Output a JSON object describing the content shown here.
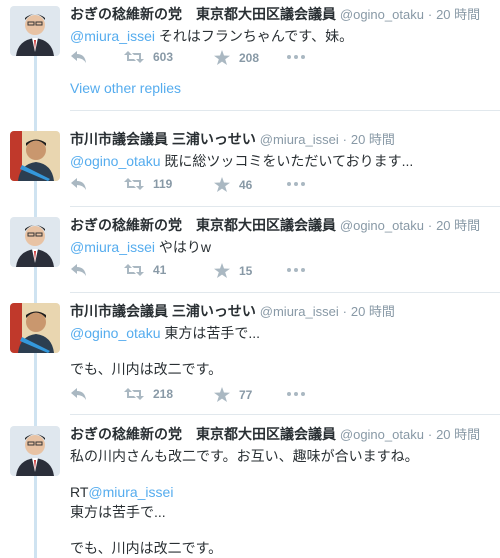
{
  "replies_link": "View other replies",
  "tweets": [
    {
      "name": "おぎの稔維新の党　東京都大田区議会議員",
      "handle": "@ogino_otaku",
      "time": "20 時間",
      "mention": "@miura_issei",
      "text": " それはフランちゃんです、妹。",
      "retweets": "603",
      "favorites": "208"
    },
    {
      "name": "市川市議会議員 三浦いっせい",
      "handle": "@miura_issei",
      "time": "20 時間",
      "mention": "@ogino_otaku",
      "text": " 既に総ツッコミをいただいております...",
      "retweets": "119",
      "favorites": "46"
    },
    {
      "name": "おぎの稔維新の党　東京都大田区議会議員",
      "handle": "@ogino_otaku",
      "time": "20 時間",
      "mention": "@miura_issei",
      "text": " やはりw",
      "retweets": "41",
      "favorites": "15"
    },
    {
      "name": "市川市議会議員 三浦いっせい",
      "handle": "@miura_issei",
      "time": "20 時間",
      "mention": "@ogino_otaku",
      "text": " 東方は苦手で...",
      "text2": "でも、川内は改二です。",
      "retweets": "218",
      "favorites": "77"
    },
    {
      "name": "おぎの稔維新の党　東京都大田区議会議員",
      "handle": "@ogino_otaku",
      "time": "20 時間",
      "text": "私の川内さんも改二です。お互い、趣味が合いますね。",
      "rt_prefix": "RT",
      "rt_mention": "@miura_issei",
      "rt_line1": "東方は苦手で...",
      "rt_line2": "でも、川内は改二です。"
    }
  ],
  "colors": {
    "link": "#55acee",
    "muted": "#8899a6",
    "thread": "#cfe3f1"
  },
  "icons": [
    "reply-icon",
    "retweet-icon",
    "favorite-icon",
    "more-icon"
  ]
}
